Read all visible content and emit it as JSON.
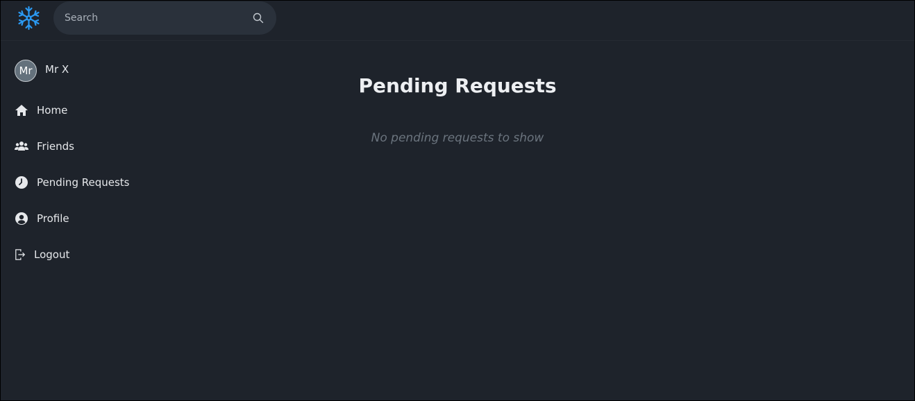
{
  "header": {
    "logo_icon": "snowflake-icon",
    "search": {
      "placeholder": "Search",
      "value": "",
      "icon": "search-icon"
    }
  },
  "sidebar": {
    "user": {
      "avatar_initials": "Mr",
      "name": "Mr X"
    },
    "items": [
      {
        "label": "Home",
        "icon": "home-icon"
      },
      {
        "label": "Friends",
        "icon": "friends-icon"
      },
      {
        "label": "Pending Requests",
        "icon": "clock-icon"
      },
      {
        "label": "Profile",
        "icon": "user-circle-icon"
      },
      {
        "label": "Logout",
        "icon": "logout-icon"
      }
    ]
  },
  "main": {
    "title": "Pending Requests",
    "empty_message": "No pending requests to show"
  },
  "colors": {
    "background": "#1e232b",
    "search_bg": "#2a313b",
    "logo_blue": "#2b9af3",
    "text": "#e6e8eb",
    "muted": "#6b747e"
  }
}
